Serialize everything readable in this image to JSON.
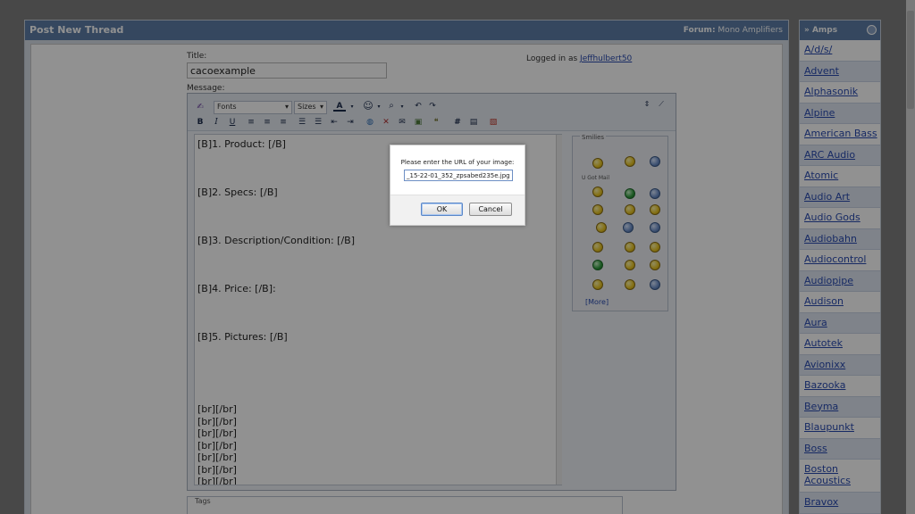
{
  "thread": {
    "header": "Post New Thread",
    "forum_label": "Forum:",
    "forum_name": "Mono Amplifiers",
    "title_label": "Title:",
    "title_value": "cacoexample",
    "logged_in_prefix": "Logged in as",
    "username": "Jeffhulbert50",
    "message_label": "Message:",
    "tags_label": "Tags"
  },
  "editor": {
    "font_select": "Fonts",
    "size_select": "Sizes",
    "message_lines": [
      "[B]1. Product: [/B]",
      "",
      "",
      "",
      "[B]2. Specs: [/B]",
      "",
      "",
      "",
      "[B]3. Description/Condition: [/B]",
      "",
      "",
      "",
      "[B]4. Price: [/B]:",
      "",
      "",
      "",
      "[B]5. Pictures: [/B]",
      "",
      "",
      "",
      "",
      "",
      "[br][/br]",
      "[br][/br]",
      "[br][/br]",
      "[br][/br]",
      "[br][/br]",
      "[br][/br]",
      "[br][/br]",
      "[br][/br]"
    ],
    "smilies_title": "Smilies",
    "smilies_group": "U Got Mail",
    "smilies_more": "[More]"
  },
  "sidebar": {
    "header": "» Amps",
    "items": [
      "A/d/s/",
      "Advent",
      "Alphasonik",
      "Alpine",
      "American Bass",
      "ARC Audio",
      "Atomic",
      "Audio Art",
      "Audio Gods",
      "Audiobahn",
      "Audiocontrol",
      "Audiopipe",
      "Audison",
      "Aura",
      "Autotek",
      "Avionixx",
      "Bazooka",
      "Beyma",
      "Blaupunkt",
      "Boss",
      "Boston Acoustics",
      "Bravox"
    ]
  },
  "dialog": {
    "prompt": "Please enter the URL of your image:",
    "url_value": "_15-22-01_352_zpsabed235e.jpg",
    "ok_label": "OK",
    "cancel_label": "Cancel"
  },
  "colors": {
    "header_blue": "#5d7ea8",
    "link_blue": "#2a4bb0",
    "overlay": "#000000"
  }
}
